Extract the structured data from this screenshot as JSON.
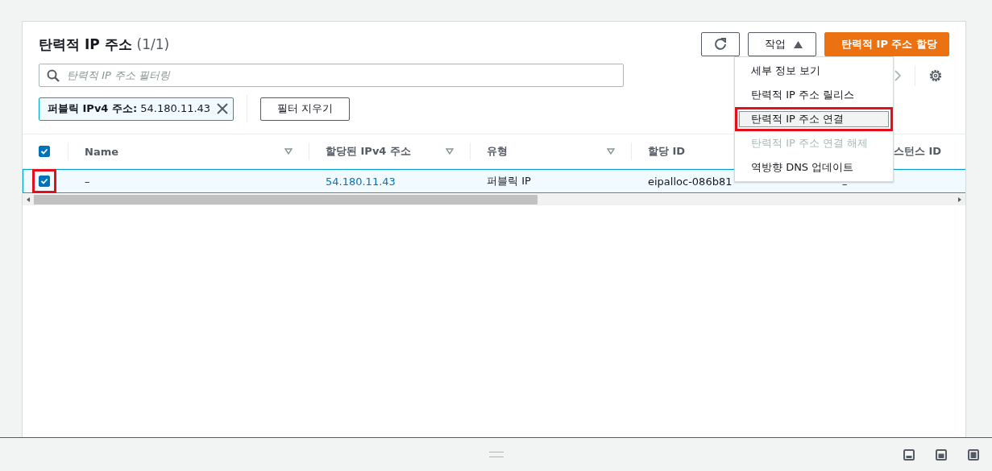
{
  "panel": {
    "title": "탄력적 IP 주소",
    "count": "(1/1)",
    "actions_button": {
      "label": "작업",
      "expanded": true
    },
    "primary_button": "탄력적 IP 주소 할당",
    "search": {
      "placeholder": "탄력적 IP 주소 필터링"
    },
    "filter_token": {
      "key": "퍼블릭 IPv4 주소:",
      "value": "54.180.11.43"
    },
    "clear_filters_button": "필터 지우기",
    "actions_menu": [
      {
        "label": "세부 정보 보기",
        "disabled": false,
        "highlighted": false,
        "annotated": false
      },
      {
        "label": "탄력적 IP 주소 릴리스",
        "disabled": false,
        "highlighted": false,
        "annotated": false
      },
      {
        "label": "탄력적 IP 주소 연결",
        "disabled": false,
        "highlighted": true,
        "annotated": true
      },
      {
        "label": "탄력적 IP 주소 연결 해제",
        "disabled": true,
        "highlighted": false,
        "annotated": false
      },
      {
        "label": "역방향 DNS 업데이트",
        "disabled": false,
        "highlighted": false,
        "annotated": false
      }
    ],
    "table": {
      "all_checked": true,
      "columns": [
        {
          "label": "Name",
          "sortable": true
        },
        {
          "label": "할당된 IPv4 주소",
          "sortable": true
        },
        {
          "label": "유형",
          "sortable": true
        },
        {
          "label": "할당 ID"
        },
        {
          "label": "스턴스 ID"
        }
      ],
      "rows": [
        {
          "selected": true,
          "annotated": true,
          "cells": [
            "–",
            "54.180.11.43",
            "퍼블릭 IP",
            "eipalloc-086b81",
            "–"
          ]
        }
      ]
    }
  }
}
